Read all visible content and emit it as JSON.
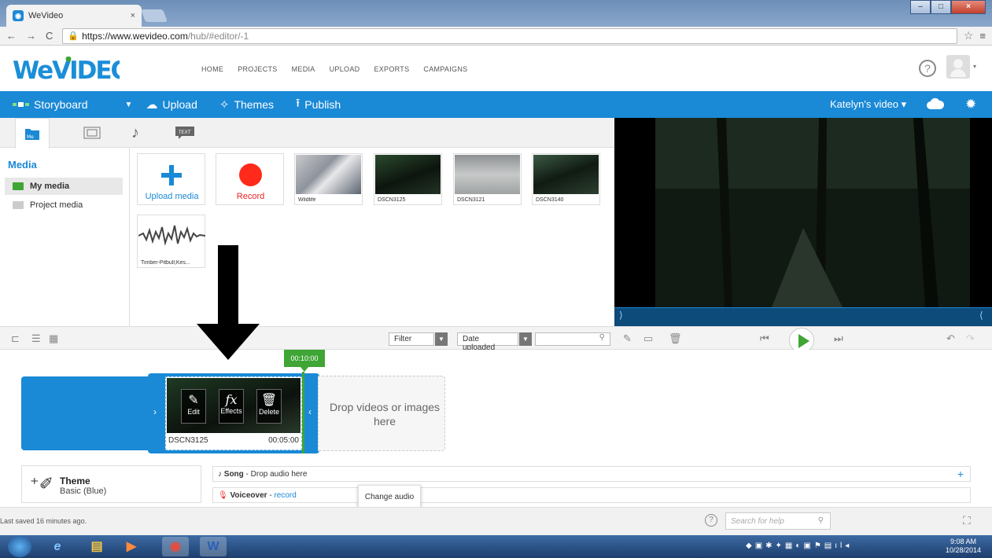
{
  "browser": {
    "tab_title": "WeVideo",
    "tab_close": "×",
    "url_host": "https://www.wevideo.com",
    "url_path": "/hub/#editor/-1"
  },
  "header": {
    "logo": "WeVideo",
    "nav": [
      "HOME",
      "PROJECTS",
      "MEDIA",
      "UPLOAD",
      "EXPORTS",
      "CAMPAIGNS"
    ]
  },
  "toolbar": {
    "storyboard": "Storyboard",
    "upload": "Upload",
    "themes": "Themes",
    "publish": "Publish",
    "project_name": "Katelyn's video ▾"
  },
  "media": {
    "title": "Media",
    "sidebar": [
      "My media",
      "Project media"
    ],
    "upload_label": "Upload media",
    "record_label": "Record",
    "items": [
      {
        "label": "Wildlife"
      },
      {
        "label": "DSCN3125"
      },
      {
        "label": "DSCN3121"
      },
      {
        "label": "DSCN3140"
      }
    ],
    "audio_label": "Timber-Pitbull;Kes..."
  },
  "midbar": {
    "filter": "Filter",
    "sort": "Date uploaded"
  },
  "timeline": {
    "time_flag": "00:10:00",
    "edit": "Edit",
    "effects": "Effects",
    "delete": "Delete",
    "clip_name": "DSCN3125",
    "clip_duration": "00:05:00",
    "drop_text": "Drop videos or images here",
    "theme_label": "Theme",
    "theme_value": "Basic (Blue)",
    "song_label": "Song",
    "song_hint": " - Drop audio here",
    "voiceover_label": "Voiceover",
    "voiceover_link": "record",
    "tooltip": "Change audio"
  },
  "status": {
    "saved": "Last saved 16 minutes ago.",
    "search_placeholder": "Search for help"
  },
  "taskbar": {
    "time": "9:08 AM",
    "date": "10/28/2014"
  },
  "colors": {
    "brand_blue": "#1a89d6",
    "accent_green": "#3fa535",
    "record_red": "#ff2a1a"
  }
}
